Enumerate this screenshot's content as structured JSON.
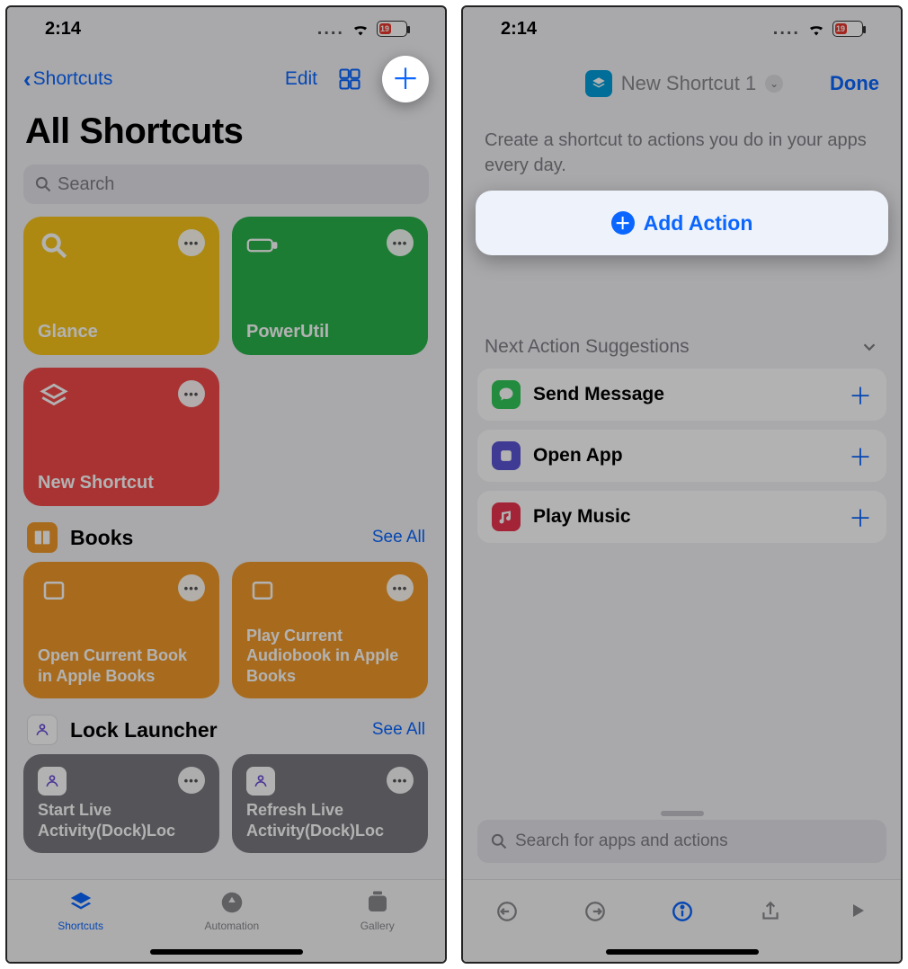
{
  "colors": {
    "blue": "#0a66ff",
    "yellow": "#f8c51b",
    "green": "#29b24a",
    "red": "#f24a4a",
    "orange": "#f19a2a",
    "gray": "#7a7a80",
    "battery_red": "#e8362b",
    "msg_green": "#32c759",
    "purple": "#5b55d6",
    "music_red": "#ea3350",
    "cyan": "#009eda"
  },
  "status": {
    "time": "2:14",
    "battery_text": "19"
  },
  "left": {
    "back_label": "Shortcuts",
    "edit": "Edit",
    "title": "All Shortcuts",
    "search_placeholder": "Search",
    "tiles": [
      {
        "label": "Glance",
        "color": "yellow",
        "icon": "search"
      },
      {
        "label": "PowerUtil",
        "color": "green",
        "icon": "battery"
      },
      {
        "label": "New Shortcut",
        "color": "red",
        "icon": "layers"
      }
    ],
    "sections": [
      {
        "name": "Books",
        "badge_color": "orange",
        "see_all": "See All",
        "tiles": [
          {
            "label": "Open Current Book in Apple Books"
          },
          {
            "label": "Play Current Audiobook in Apple Books"
          }
        ]
      },
      {
        "name": "Lock Launcher",
        "badge_color": "white",
        "see_all": "See All",
        "tiles": [
          {
            "label": "Start Live Activity(Dock)Loc"
          },
          {
            "label": "Refresh Live Activity(Dock)Loc"
          }
        ]
      }
    ],
    "tabs": [
      {
        "label": "Shortcuts",
        "active": true
      },
      {
        "label": "Automation",
        "active": false
      },
      {
        "label": "Gallery",
        "active": false
      }
    ]
  },
  "right": {
    "title": "New Shortcut 1",
    "done": "Done",
    "description": "Create a shortcut to actions you do in your apps every day.",
    "add_action": "Add Action",
    "suggestions_title": "Next Action Suggestions",
    "suggestions": [
      {
        "label": "Send Message",
        "color": "msg_green"
      },
      {
        "label": "Open App",
        "color": "purple"
      },
      {
        "label": "Play Music",
        "color": "music_red"
      }
    ],
    "search_placeholder": "Search for apps and actions"
  }
}
